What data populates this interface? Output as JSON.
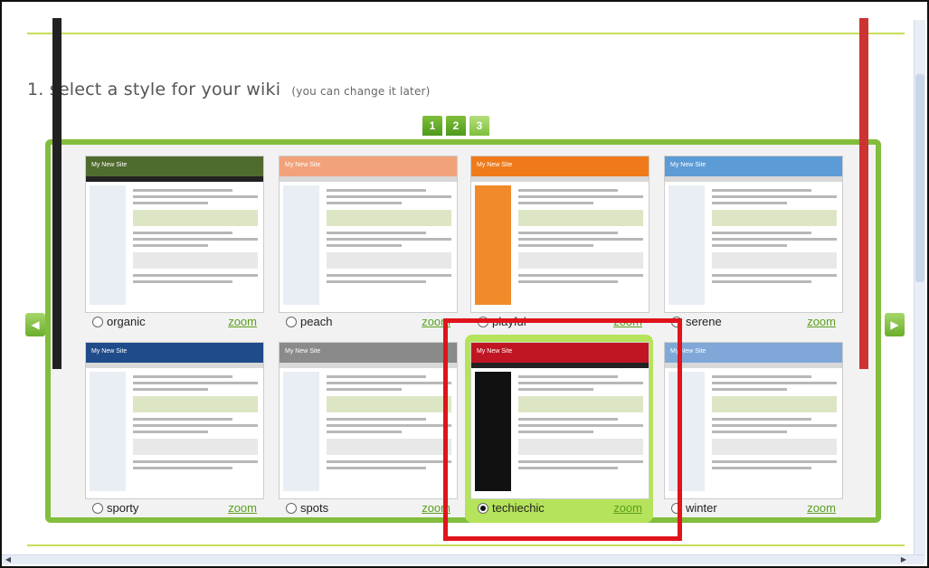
{
  "heading": {
    "title": "1. select a style for your wiki",
    "subtitle": "(you can change it later)"
  },
  "pager": [
    "1",
    "2",
    "3"
  ],
  "thumb_title": "My New Site",
  "zoom_label": "zoom",
  "styles": [
    {
      "name": "organic",
      "selected": false,
      "accent": "#4f6b2e"
    },
    {
      "name": "peach",
      "selected": false,
      "accent": "#f2a27a"
    },
    {
      "name": "playful",
      "selected": false,
      "accent": "#f07a1a"
    },
    {
      "name": "serene",
      "selected": false,
      "accent": "#5c9bd6"
    },
    {
      "name": "sporty",
      "selected": false,
      "accent": "#1f4b8a"
    },
    {
      "name": "spots",
      "selected": false,
      "accent": "#8a8a8a"
    },
    {
      "name": "techiechic",
      "selected": true,
      "accent": "#c01623"
    },
    {
      "name": "winter",
      "selected": false,
      "accent": "#7fa8d8"
    }
  ],
  "colors": {
    "green": "#82bd3d",
    "highlight": "#e0141b",
    "selection_bg": "#b5e35b",
    "rule": "#c9dd58"
  }
}
